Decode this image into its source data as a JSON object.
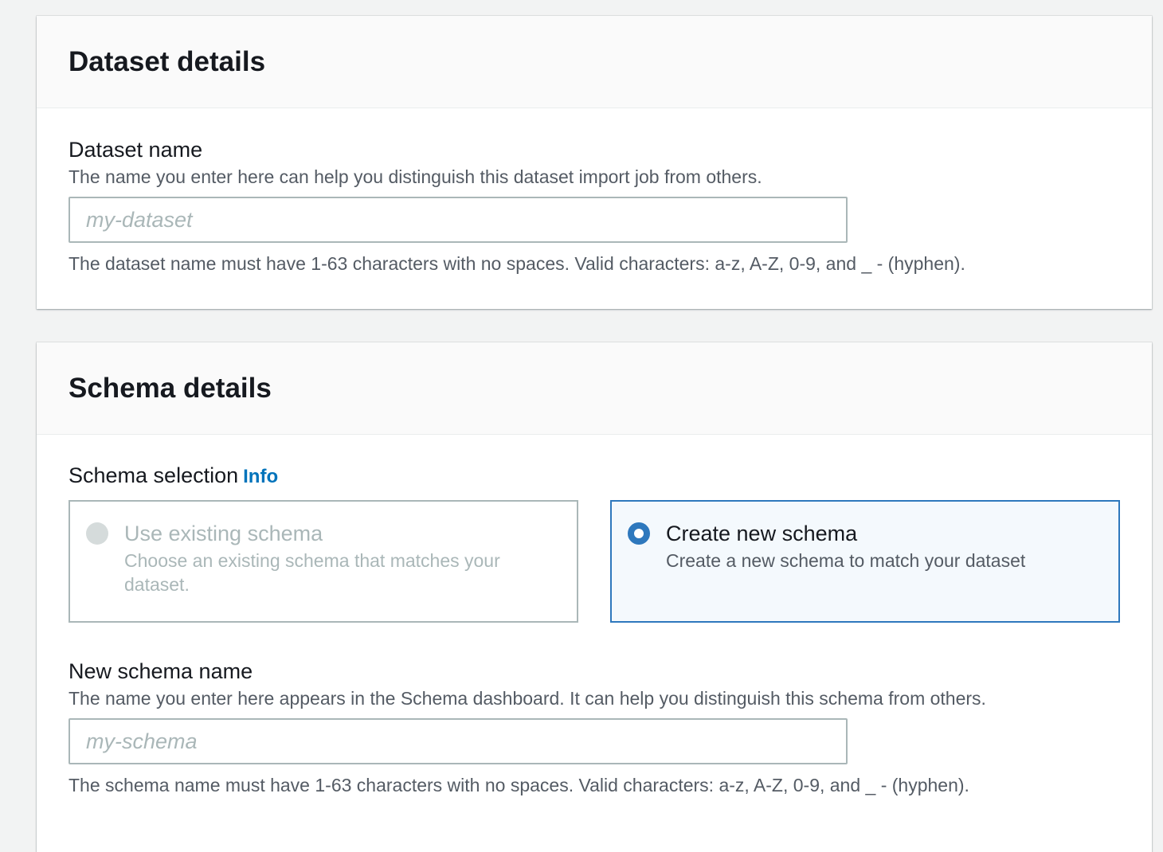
{
  "dataset_details": {
    "title": "Dataset details",
    "name_label": "Dataset name",
    "name_description": "The name you enter here can help you distinguish this dataset import job from others.",
    "name_placeholder": "my-dataset",
    "name_value": "",
    "name_constraint": "The dataset name must have 1-63 characters with no spaces. Valid characters: a-z, A-Z, 0-9, and _ - (hyphen)."
  },
  "schema_details": {
    "title": "Schema selection",
    "header": "Schema details",
    "selection_label": "Schema selection",
    "info_link": "Info",
    "options": [
      {
        "title": "Use existing schema",
        "description": "Choose an existing schema that matches your dataset.",
        "selected": false,
        "disabled": true
      },
      {
        "title": "Create new schema",
        "description": "Create a new schema to match your dataset",
        "selected": true,
        "disabled": false
      }
    ],
    "new_name_label": "New schema name",
    "new_name_description": "The name you enter here appears in the Schema dashboard. It can help you distinguish this schema from others.",
    "new_name_placeholder": "my-schema",
    "new_name_value": "",
    "new_name_constraint": "The schema name must have 1-63 characters with no spaces. Valid characters: a-z, A-Z, 0-9, and _ - (hyphen)."
  },
  "colors": {
    "accent": "#2e78bd",
    "link": "#0073bb",
    "background": "#f2f3f3"
  }
}
